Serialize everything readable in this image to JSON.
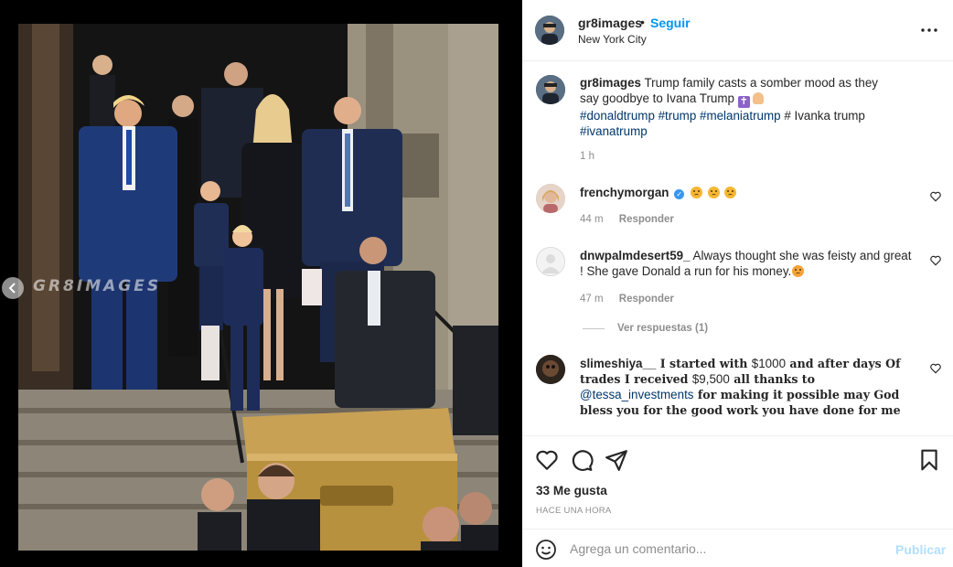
{
  "post": {
    "username": "gr8images",
    "follow_label": "Seguir",
    "location": "New York City",
    "separator": "•"
  },
  "photo": {
    "watermark": "GR8IMAGES",
    "colors": {
      "suit_blue": "#1f3a78",
      "dark_suit": "#22252e",
      "casket_gold": "#b8913e",
      "stone": "#8d8678"
    }
  },
  "caption": {
    "username": "gr8images",
    "text": "Trump family casts a somber mood as they say goodbye to Ivana Trump",
    "hashtags_line": "#donaldtrump #trump #melaniatrump",
    "hashtags_extra": "# Ivanka trump",
    "hashtag_last": "#ivanatrump",
    "time": "1 h"
  },
  "comments": [
    {
      "username": "frenchymorgan",
      "verified": true,
      "text": "",
      "time": "44 m",
      "reply_label": "Responder"
    },
    {
      "username": "dnwpalmdesert59_",
      "text": "Always thought she was feisty and great ! She gave Donald a run for his money.",
      "time": "47 m",
      "reply_label": "Responder",
      "view_replies": "Ver respuestas (1)"
    },
    {
      "username": "slimeshiya__",
      "text_a": "I started with",
      "amount_a": "$1000",
      "text_b": "and after days Of trades I received",
      "amount_b": "$9,500",
      "text_c": "all thanks to",
      "mention": "@tessa_investments",
      "text_d": "for making it possible may God bless you for the good work you have done for me"
    }
  ],
  "footer": {
    "likes_count": "33",
    "likes_label": "Me gusta",
    "time_ago": "HACE UNA HORA",
    "comment_placeholder": "Agrega un comentario...",
    "publish_label": "Publicar"
  },
  "icons": {
    "more": "more-horizontal-icon",
    "like": "heart-icon",
    "comment": "comment-icon",
    "share": "share-icon",
    "save": "bookmark-icon",
    "emoji": "emoji-icon",
    "prev": "chevron-left-icon"
  },
  "colors": {
    "accent": "#0095f6",
    "link": "#00376b",
    "muted": "#8e8e8e",
    "publish_disabled": "#b2dffc"
  }
}
